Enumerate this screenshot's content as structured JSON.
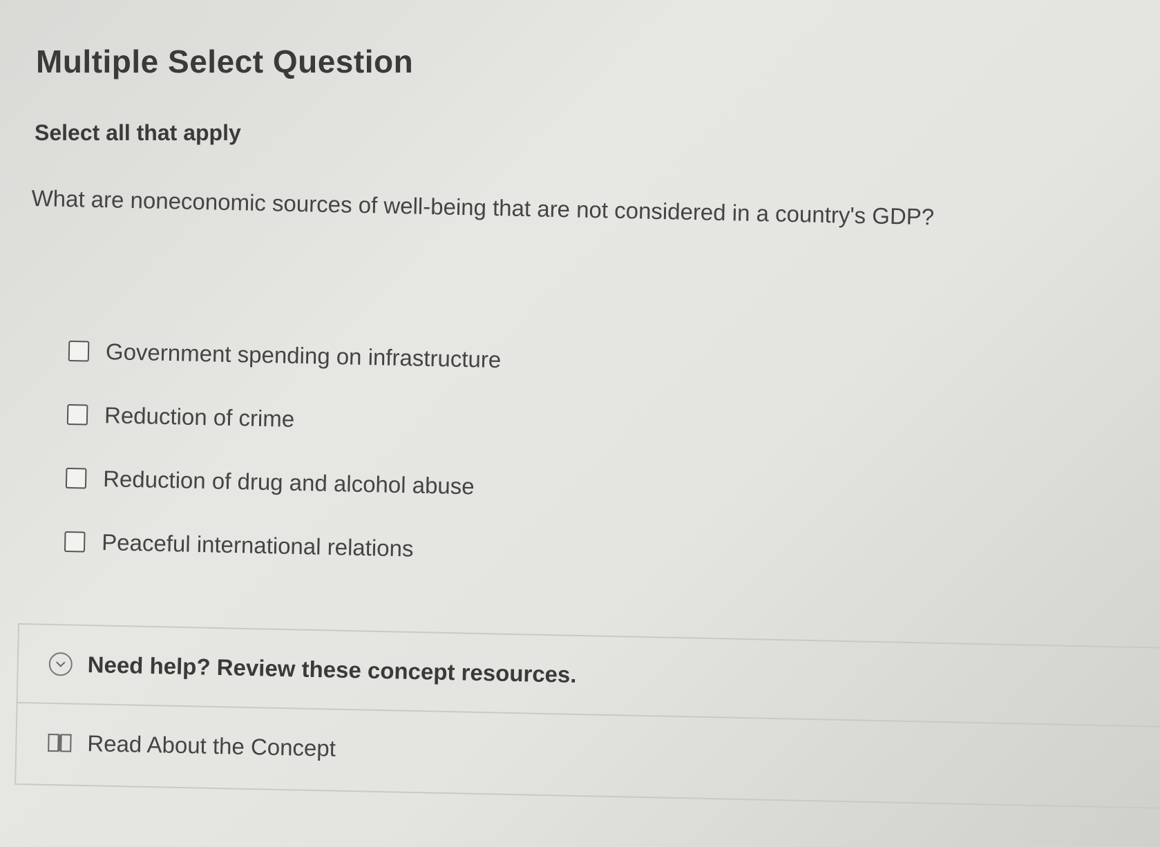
{
  "question": {
    "type_label": "Multiple Select Question",
    "instruction": "Select all that apply",
    "prompt": "What are noneconomic sources of well-being that are not considered in a country's GDP?"
  },
  "choices": [
    {
      "label": "Government spending on infrastructure",
      "checked": false
    },
    {
      "label": "Reduction of crime",
      "checked": false
    },
    {
      "label": "Reduction of drug and alcohol abuse",
      "checked": false
    },
    {
      "label": "Peaceful international relations",
      "checked": false
    }
  ],
  "help": {
    "title": "Need help? Review these concept resources.",
    "toggle_icon": "chevron-down-circle-icon",
    "resources": [
      {
        "label": "Read About the Concept",
        "icon": "book-icon"
      }
    ]
  }
}
